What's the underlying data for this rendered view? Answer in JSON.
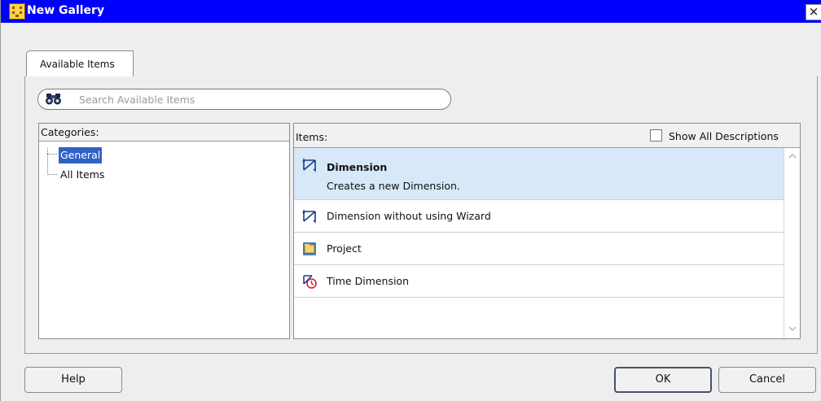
{
  "window": {
    "title": "New Gallery",
    "close_glyph": "×"
  },
  "tabs": [
    {
      "label": "Available Items"
    }
  ],
  "search": {
    "placeholder": "Search Available Items",
    "value": ""
  },
  "categories": {
    "header": "Categories:",
    "items": [
      {
        "label": "General",
        "selected": true
      },
      {
        "label": "All Items",
        "selected": false
      }
    ]
  },
  "items": {
    "header": "Items:",
    "show_all_label": "Show All Descriptions",
    "show_all_checked": false,
    "list": [
      {
        "title": "Dimension",
        "description": "Creates a new Dimension.",
        "icon": "dimension-icon",
        "selected": true
      },
      {
        "title": "Dimension without using Wizard",
        "icon": "dimension-icon",
        "selected": false
      },
      {
        "title": "Project",
        "icon": "project-folder-icon",
        "selected": false
      },
      {
        "title": "Time Dimension",
        "icon": "time-dimension-icon",
        "selected": false
      }
    ]
  },
  "buttons": {
    "help": "Help",
    "ok": "OK",
    "cancel": "Cancel"
  },
  "colors": {
    "titlebar": "#0000ff",
    "selection": "#3162c6",
    "selected_row": "#d7e8f8"
  }
}
